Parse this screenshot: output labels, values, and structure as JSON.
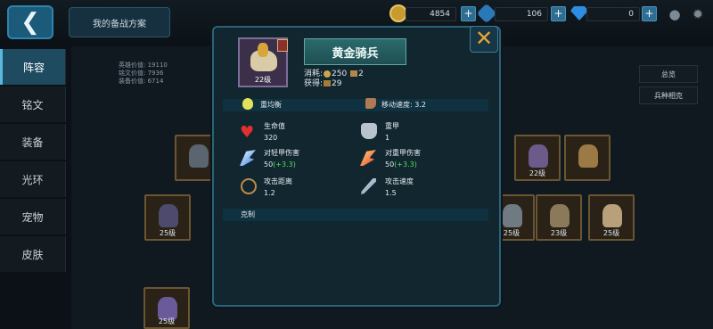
{
  "topbar": {
    "back_label": "❮",
    "plan_button": "我的备战方案",
    "gold": "4854",
    "gems_blue": "106",
    "diamonds": "0",
    "plus": "+"
  },
  "sidebar": {
    "items": [
      {
        "label": "阵容",
        "active": true
      },
      {
        "label": "铭文",
        "active": false
      },
      {
        "label": "装备",
        "active": false
      },
      {
        "label": "光环",
        "active": false
      },
      {
        "label": "宠物",
        "active": false
      },
      {
        "label": "皮肤",
        "active": false
      }
    ]
  },
  "background": {
    "stats": [
      "英雄价值: 19110",
      "铭文价值: 7936",
      "装备价值: 6714"
    ],
    "right_buttons": [
      "总览",
      "兵种相克"
    ],
    "cards": [
      {
        "level": ""
      },
      {
        "level": "22级"
      },
      {
        "level": ""
      },
      {
        "level": "25级"
      },
      {
        "level": "25级"
      },
      {
        "level": "23级"
      },
      {
        "level": "25级"
      },
      {
        "level": "25级"
      }
    ]
  },
  "modal": {
    "portrait_level": "22级",
    "unit_name": "黄金骑兵",
    "cost_label": "消耗:",
    "cost_gold": "250",
    "cost_food": "2",
    "gain_label": "获得:",
    "gain_value": "29",
    "type_label": "重均衡",
    "move_speed": "移动速度: 3.2",
    "attrs": {
      "hp": {
        "label": "生命值",
        "value": "320"
      },
      "armor": {
        "label": "重甲",
        "value": "1"
      },
      "light_dmg": {
        "label": "对轻甲伤害",
        "base": "50",
        "bonus": "(+3.3)"
      },
      "heavy_dmg": {
        "label": "对重甲伤害",
        "base": "50",
        "bonus": "(+3.3)"
      },
      "range": {
        "label": "攻击距离",
        "value": "1.2"
      },
      "atk_speed": {
        "label": "攻击速度",
        "value": "1.5"
      }
    },
    "counter_label": "克制",
    "close": "✕"
  },
  "colors": {
    "accent": "#2c6278",
    "bonus_green": "#4fe05e",
    "close_orange": "#e6a437"
  }
}
